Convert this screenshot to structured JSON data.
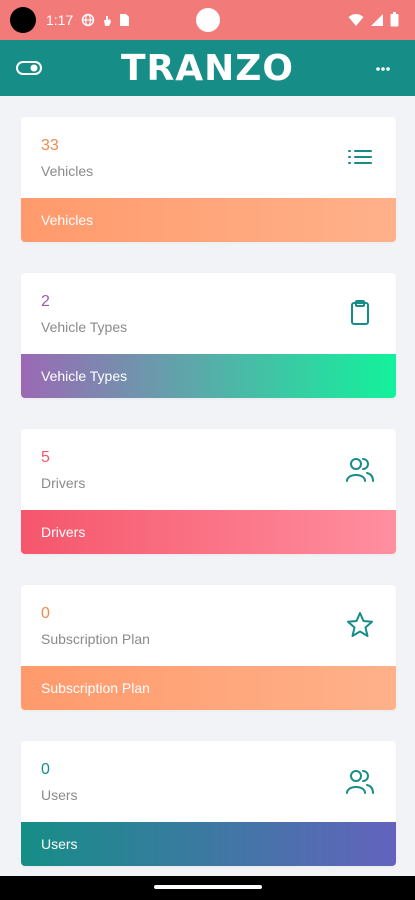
{
  "status_bar": {
    "time": "1:17",
    "bg_color": "#f27a78",
    "left_icons": [
      "globe-icon",
      "hand-icon",
      "sim-card-icon"
    ],
    "right_icons": [
      "wifi-icon",
      "signal-icon",
      "battery-icon"
    ]
  },
  "app_bar": {
    "title": "TRANZO",
    "bg_color": "#168e87",
    "left_icon": "toggle-icon",
    "right_icon": "more-dots-icon"
  },
  "cards": [
    {
      "count": "33",
      "label": "Vehicles",
      "footer": "Vehicles",
      "count_color": "#f08a4b",
      "icon": "list-icon"
    },
    {
      "count": "2",
      "label": "Vehicle Types",
      "footer": "Vehicle Types",
      "count_color": "#9b59b6",
      "icon": "clipboard-icon"
    },
    {
      "count": "5",
      "label": "Drivers",
      "footer": "Drivers",
      "count_color": "#f5566c",
      "icon": "users-icon"
    },
    {
      "count": "0",
      "label": "Subscription Plan",
      "footer": "Subscription Plan",
      "count_color": "#f08a4b",
      "icon": "star-icon"
    },
    {
      "count": "0",
      "label": "Users",
      "footer": "Users",
      "count_color": "#168e87",
      "icon": "users-icon"
    }
  ]
}
